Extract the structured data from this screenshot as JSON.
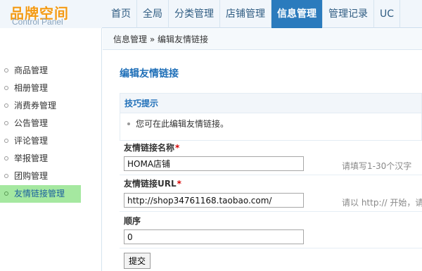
{
  "logo": {
    "title": "品牌空间",
    "subtitle": "Control Panel"
  },
  "nav": {
    "items": [
      {
        "label": "首页"
      },
      {
        "label": "全局"
      },
      {
        "label": "分类管理"
      },
      {
        "label": "店铺管理"
      },
      {
        "label": "信息管理"
      },
      {
        "label": "管理记录"
      },
      {
        "label": "UC"
      }
    ],
    "active_index": 4
  },
  "sidebar": {
    "items": [
      {
        "label": "商品管理"
      },
      {
        "label": "相册管理"
      },
      {
        "label": "消费券管理"
      },
      {
        "label": "公告管理"
      },
      {
        "label": "评论管理"
      },
      {
        "label": "举报管理"
      },
      {
        "label": "团购管理"
      },
      {
        "label": "友情链接管理"
      }
    ],
    "active_index": 7
  },
  "breadcrumb": {
    "text": "信息管理 » 编辑友情链接"
  },
  "page": {
    "title": "编辑友情链接"
  },
  "tips": {
    "heading": "技巧提示",
    "text": "您可在此编辑友情链接。"
  },
  "form": {
    "name": {
      "label": "友情链接名称",
      "required": "*",
      "value": "HOMA店铺",
      "hint": "请填写1-30个汉字"
    },
    "url": {
      "label": "友情链接URL",
      "required": "*",
      "value": "http://shop34761168.taobao.com/",
      "hint": "请以 http:// 开始，请"
    },
    "order": {
      "label": "顺序",
      "value": "0"
    },
    "submit_label": "提交"
  },
  "colors": {
    "nav_active": "#2b7bbd",
    "sidebar_active": "#a5e8a0",
    "title_blue": "#1f6fb8",
    "logo_orange": "#f39a13"
  }
}
